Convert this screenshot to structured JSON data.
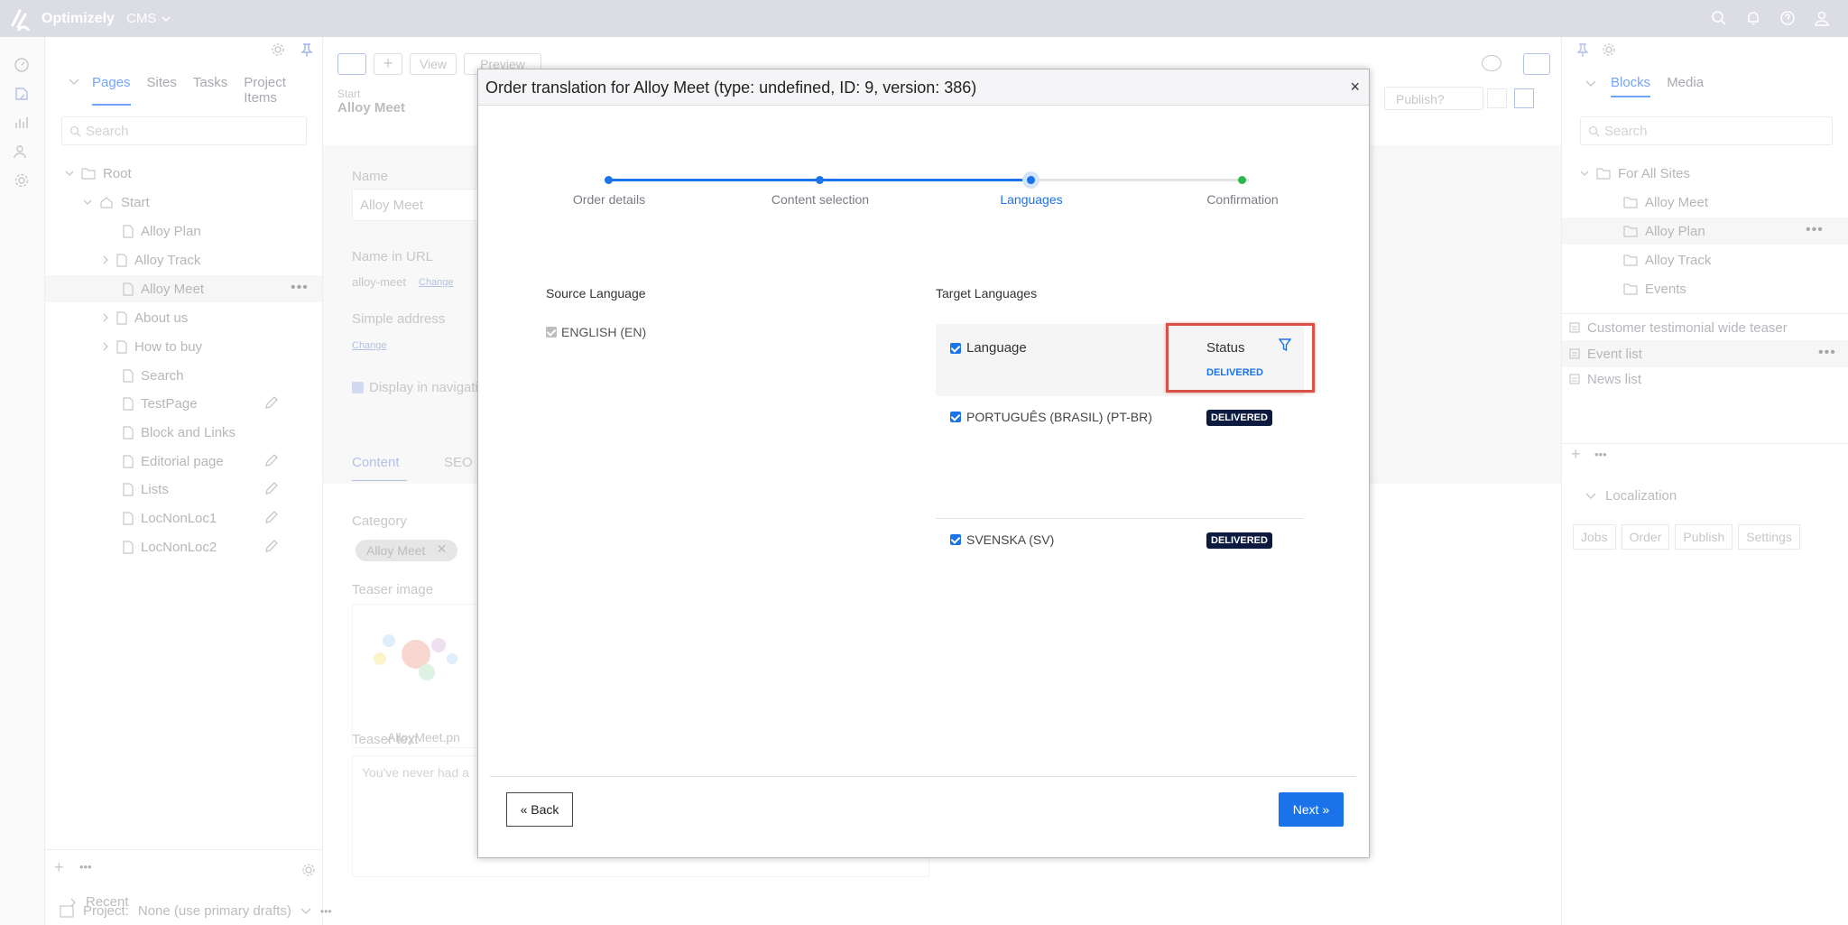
{
  "app": {
    "brand": "Optimizely",
    "product": "CMS"
  },
  "nav": {
    "tabs": [
      "Pages",
      "Sites",
      "Tasks",
      "Project Items"
    ],
    "search_placeholder": "Search",
    "tree": [
      {
        "label": "Root"
      },
      {
        "label": "Start"
      },
      {
        "label": "Alloy Plan"
      },
      {
        "label": "Alloy Track"
      },
      {
        "label": "Alloy Meet"
      },
      {
        "label": "About us"
      },
      {
        "label": "How to buy"
      },
      {
        "label": "Search"
      },
      {
        "label": "TestPage"
      },
      {
        "label": "Block and Links"
      },
      {
        "label": "Editorial page"
      },
      {
        "label": "Lists"
      },
      {
        "label": "LocNonLoc1"
      },
      {
        "label": "LocNonLoc2"
      }
    ],
    "recent": "Recent"
  },
  "editor": {
    "toolbar_view": "View",
    "toolbar_preview": "Preview",
    "publish": "Publish?",
    "breadcrumb": "Start",
    "page_title": "Alloy Meet",
    "name_label": "Name",
    "name_value": "Alloy Meet",
    "url_label": "Name in URL",
    "url_value": "alloy-meet",
    "change": "Change",
    "simple_address": "Simple address",
    "display_nav": "Display in navigati",
    "tab_content": "Content",
    "tab_seo": "SEO",
    "category_label": "Category",
    "category_tag": "Alloy Meet",
    "teaser_image": "Teaser image",
    "image_name": "AlloyMeet.pn",
    "teaser_text": "Teaser text",
    "teaser_value": "You've never had a"
  },
  "right": {
    "tabs": [
      "Blocks",
      "Media"
    ],
    "search_placeholder": "Search",
    "tree": [
      "For All Sites",
      "Alloy Meet",
      "Alloy Plan",
      "Alloy Track",
      "Events"
    ],
    "list": [
      "Customer testimonial wide teaser",
      "Event list",
      "News list"
    ],
    "localization": "Localization",
    "loc_buttons": [
      "Jobs",
      "Order",
      "Publish",
      "Settings"
    ]
  },
  "bottom": {
    "project": "Project:",
    "project_value": "None (use primary drafts)"
  },
  "dialog": {
    "title": "Order translation for Alloy Meet (type: undefined, ID: 9, version: 386)",
    "close": "×",
    "steps": [
      "Order details",
      "Content selection",
      "Languages",
      "Confirmation"
    ],
    "source_label": "Source Language",
    "source_lang": "ENGLISH (EN)",
    "target_label": "Target Languages",
    "col_language": "Language",
    "col_status": "Status",
    "filter_value": "DELIVERED",
    "rows": [
      {
        "lang": "PORTUGUÊS (BRASIL) (PT-BR)",
        "status": "DELIVERED"
      },
      {
        "lang": "SVENSKA (SV)",
        "status": "DELIVERED"
      }
    ],
    "back": "« Back",
    "next": "Next »"
  },
  "colors": {
    "accent": "#1a73e8",
    "badge": "#0b1a3e",
    "highlight": "#d9524a",
    "complete": "#2eb84b"
  }
}
